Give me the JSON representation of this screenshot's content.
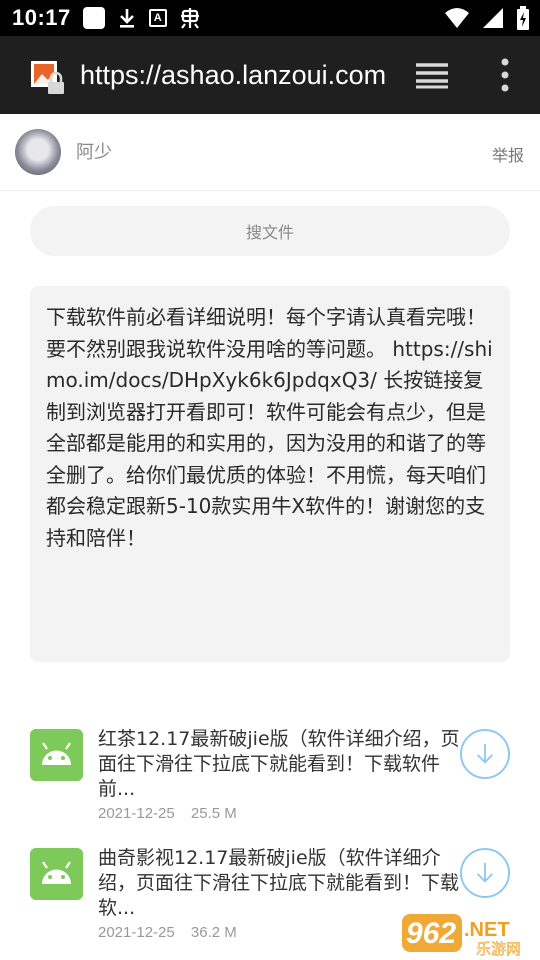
{
  "status_bar": {
    "time": "10:17",
    "icons": [
      "square-icon",
      "download-icon",
      "a-icon",
      "bug-icon",
      "wifi-icon",
      "signal-icon",
      "battery-icon"
    ]
  },
  "browser": {
    "url": "https://ashao.lanzoui.com",
    "icons": [
      "site-lock-icon",
      "tabs-icon",
      "more-menu-icon"
    ]
  },
  "user": {
    "name": "阿少",
    "report_label": "举报"
  },
  "search": {
    "placeholder": "搜文件"
  },
  "notice": {
    "text": "下载软件前必看详细说明！每个字请认真看完哦！ 要不然别跟我说软件没用啥的等问题。 https://shimo.im/docs/DHpXyk6k6JpdqxQ3/ 长按链接复制到浏览器打开看即可！软件可能会有点少，但是全部都是能用的和实用的，因为没用的和谐了的等全删了。给你们最优质的体验！不用慌，每天咱们都会稳定跟新5-10款实用牛X软件的！谢谢您的支持和陪伴！"
  },
  "files": [
    {
      "name": "红茶12.17最新破jie版（软件详细介绍，页面往下滑往下拉底下就能看到！下载软件前...",
      "date": "2021-12-25",
      "size": "25.5 M"
    },
    {
      "name": "曲奇影视12.17最新破jie版（软件详细介绍，页面往下滑往下拉底下就能看到！下载软...",
      "date": "2021-12-25",
      "size": "36.2 M"
    }
  ],
  "watermark": {
    "brand_number": "962",
    "brand_suffix": ".NET",
    "site_name": "乐游网"
  },
  "colors": {
    "status_bar": "#000000",
    "toolbar": "#1f1f1f",
    "app_icon_green": "#7dc95a",
    "download_ring": "#8fc9f0",
    "watermark_orange": "#f0a020"
  }
}
